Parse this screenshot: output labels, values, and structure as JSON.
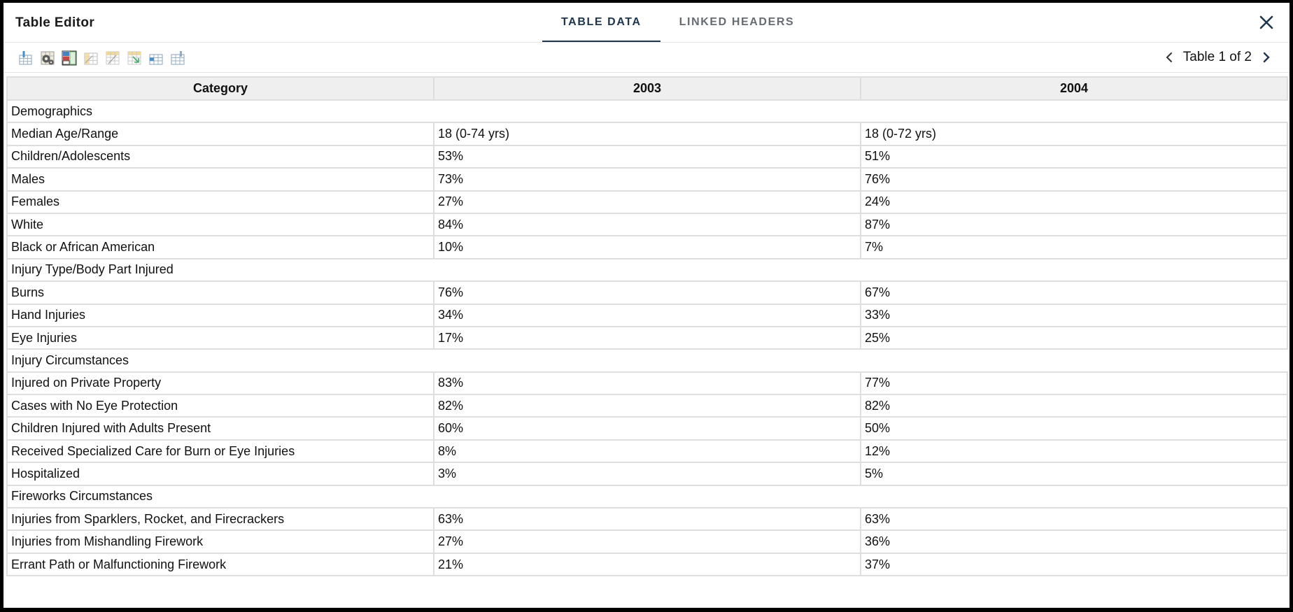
{
  "window": {
    "title": "Table Editor"
  },
  "tabs": [
    {
      "label": "TABLE DATA",
      "active": true
    },
    {
      "label": "LINKED HEADERS",
      "active": false
    }
  ],
  "toolbar": {
    "icons": [
      "insert-column-icon",
      "table-settings-icon",
      "header-cells-icon",
      "merge-cells-icon",
      "split-cells-icon",
      "select-cells-icon",
      "insert-row-icon",
      "delete-column-icon"
    ],
    "pager_label": "Table 1 of 2"
  },
  "colors": {
    "accent": "#20354e",
    "tab_inactive": "#666c72",
    "header_bg": "#efefef",
    "grid": "#dedede"
  },
  "table": {
    "headers": [
      "Category",
      "2003",
      "2004"
    ],
    "rows": [
      {
        "section": "Demographics"
      },
      {
        "cells": [
          "Median Age/Range",
          "18 (0-74 yrs)",
          "18 (0-72 yrs)"
        ]
      },
      {
        "cells": [
          "Children/Adolescents",
          "53%",
          "51%"
        ]
      },
      {
        "cells": [
          "Males",
          "73%",
          "76%"
        ]
      },
      {
        "cells": [
          "Females",
          "27%",
          "24%"
        ]
      },
      {
        "cells": [
          "White",
          "84%",
          "87%"
        ]
      },
      {
        "cells": [
          "Black or African American",
          "10%",
          "7%"
        ]
      },
      {
        "section": "Injury Type/Body Part Injured"
      },
      {
        "cells": [
          "Burns",
          "76%",
          "67%"
        ]
      },
      {
        "cells": [
          "Hand Injuries",
          "34%",
          "33%"
        ]
      },
      {
        "cells": [
          "Eye Injuries",
          "17%",
          "25%"
        ]
      },
      {
        "section": "Injury Circumstances"
      },
      {
        "cells": [
          "Injured on Private Property",
          "83%",
          "77%"
        ]
      },
      {
        "cells": [
          "Cases with No Eye Protection",
          "82%",
          "82%"
        ]
      },
      {
        "cells": [
          "Children Injured with Adults Present",
          "60%",
          "50%"
        ]
      },
      {
        "cells": [
          "Received Specialized Care for Burn or Eye Injuries",
          "8%",
          "12%"
        ]
      },
      {
        "cells": [
          "Hospitalized",
          "3%",
          "5%"
        ]
      },
      {
        "section": "Fireworks Circumstances"
      },
      {
        "cells": [
          "Injuries from Sparklers, Rocket, and Firecrackers",
          "63%",
          "63%"
        ]
      },
      {
        "cells": [
          "Injuries from Mishandling Firework",
          "27%",
          "36%"
        ]
      },
      {
        "cells": [
          "Errant Path or Malfunctioning Firework",
          "21%",
          "37%"
        ]
      }
    ]
  }
}
